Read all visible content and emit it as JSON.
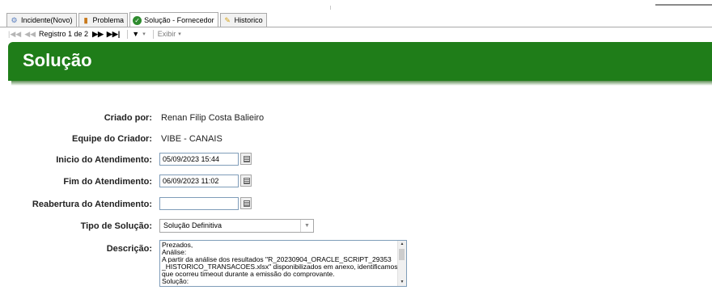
{
  "tabs": [
    {
      "label": "Incidente(Novo)",
      "icon": "incident-icon"
    },
    {
      "label": "Problema",
      "icon": "problem-icon"
    },
    {
      "label": "Solução - Fornecedor",
      "icon": "check-icon",
      "active": true
    },
    {
      "label": "Historico",
      "icon": "pencil-icon"
    }
  ],
  "nav": {
    "record_label": "Registro 1 de 2",
    "view_label": "Exibir"
  },
  "banner": {
    "title": "Solução",
    "color": "#1f7d19"
  },
  "form": {
    "criado_por": {
      "label": "Criado por:",
      "value": "Renan Filip Costa Balieiro"
    },
    "equipe": {
      "label": "Equipe do Criador:",
      "value": "VIBE - CANAIS"
    },
    "inicio": {
      "label": "Inicio do Atendimento:",
      "value": "05/09/2023 15:44"
    },
    "fim": {
      "label": "Fim do Atendimento:",
      "value": "06/09/2023 11:02"
    },
    "reabertura": {
      "label": "Reabertura do Atendimento:",
      "value": ""
    },
    "tipo": {
      "label": "Tipo de Solução:",
      "value": "Solução Definitiva"
    },
    "descricao": {
      "label": "Descrição:",
      "lines": [
        "Prezados,",
        "Análise:",
        "A partir da análise dos resultados \"R_20230904_ORACLE_SCRIPT_29353",
        "_HISTORICO_TRANSACOES.xlsx\" disponibilizados em anexo, identificamos",
        "que ocorreu timeout durante a emissão do comprovante.",
        "Solução:"
      ]
    }
  }
}
